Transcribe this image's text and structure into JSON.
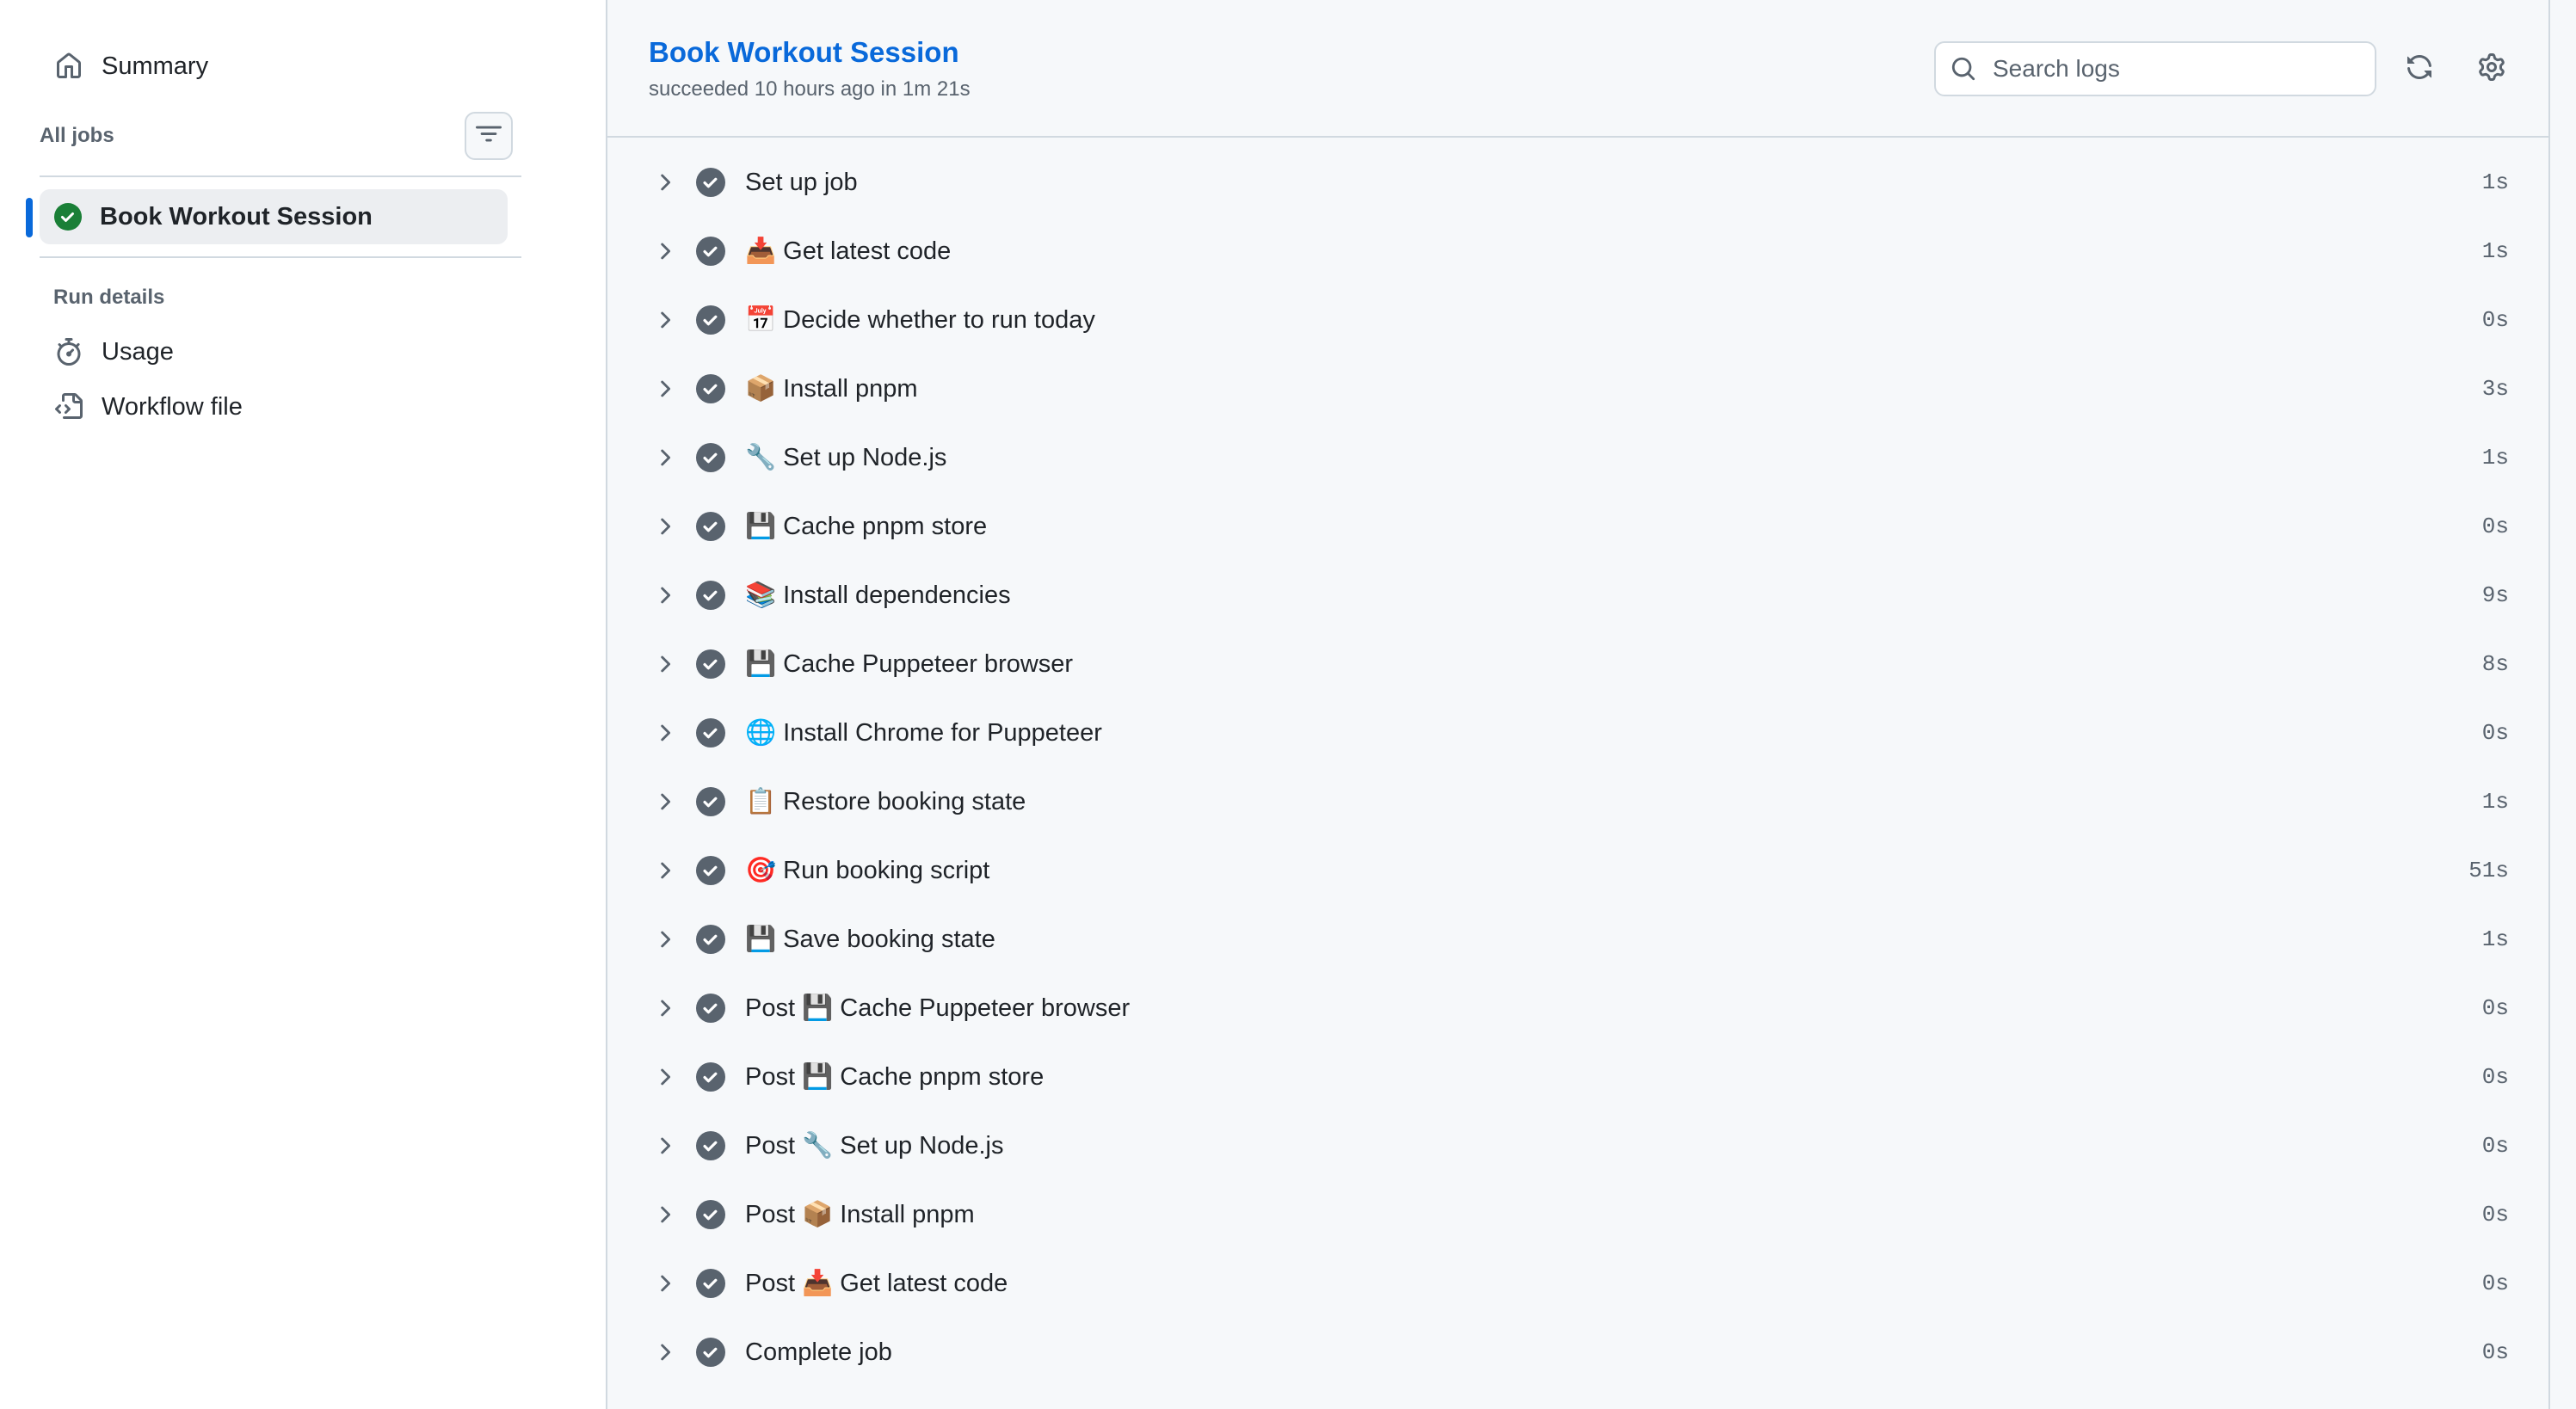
{
  "sidebar": {
    "summary_label": "Summary",
    "all_jobs_label": "All jobs",
    "jobs": [
      {
        "label": "Book Workout Session",
        "status": "success",
        "selected": true
      }
    ],
    "run_details_label": "Run details",
    "links": [
      {
        "label": "Usage",
        "icon": "stopwatch-icon"
      },
      {
        "label": "Workflow file",
        "icon": "file-code-icon"
      }
    ]
  },
  "header": {
    "title": "Book Workout Session",
    "subtitle": "succeeded 10 hours ago in 1m 21s",
    "search_placeholder": "Search logs"
  },
  "steps": [
    {
      "name": "Set up job",
      "duration": "1s"
    },
    {
      "name": "📥 Get latest code",
      "duration": "1s"
    },
    {
      "name": "📅 Decide whether to run today",
      "duration": "0s"
    },
    {
      "name": "📦 Install pnpm",
      "duration": "3s"
    },
    {
      "name": "🔧 Set up Node.js",
      "duration": "1s"
    },
    {
      "name": "💾 Cache pnpm store",
      "duration": "0s"
    },
    {
      "name": "📚 Install dependencies",
      "duration": "9s"
    },
    {
      "name": "💾 Cache Puppeteer browser",
      "duration": "8s"
    },
    {
      "name": "🌐 Install Chrome for Puppeteer",
      "duration": "0s"
    },
    {
      "name": "📋 Restore booking state",
      "duration": "1s"
    },
    {
      "name": "🎯 Run booking script",
      "duration": "51s"
    },
    {
      "name": "💾 Save booking state",
      "duration": "1s"
    },
    {
      "name": "Post 💾 Cache Puppeteer browser",
      "duration": "0s"
    },
    {
      "name": "Post 💾 Cache pnpm store",
      "duration": "0s"
    },
    {
      "name": "Post 🔧 Set up Node.js",
      "duration": "0s"
    },
    {
      "name": "Post 📦 Install pnpm",
      "duration": "0s"
    },
    {
      "name": "Post 📥 Get latest code",
      "duration": "0s"
    },
    {
      "name": "Complete job",
      "duration": "0s"
    }
  ],
  "colors": {
    "accent": "#0969da",
    "success": "#1a7f37",
    "step_check": "#59636e"
  }
}
